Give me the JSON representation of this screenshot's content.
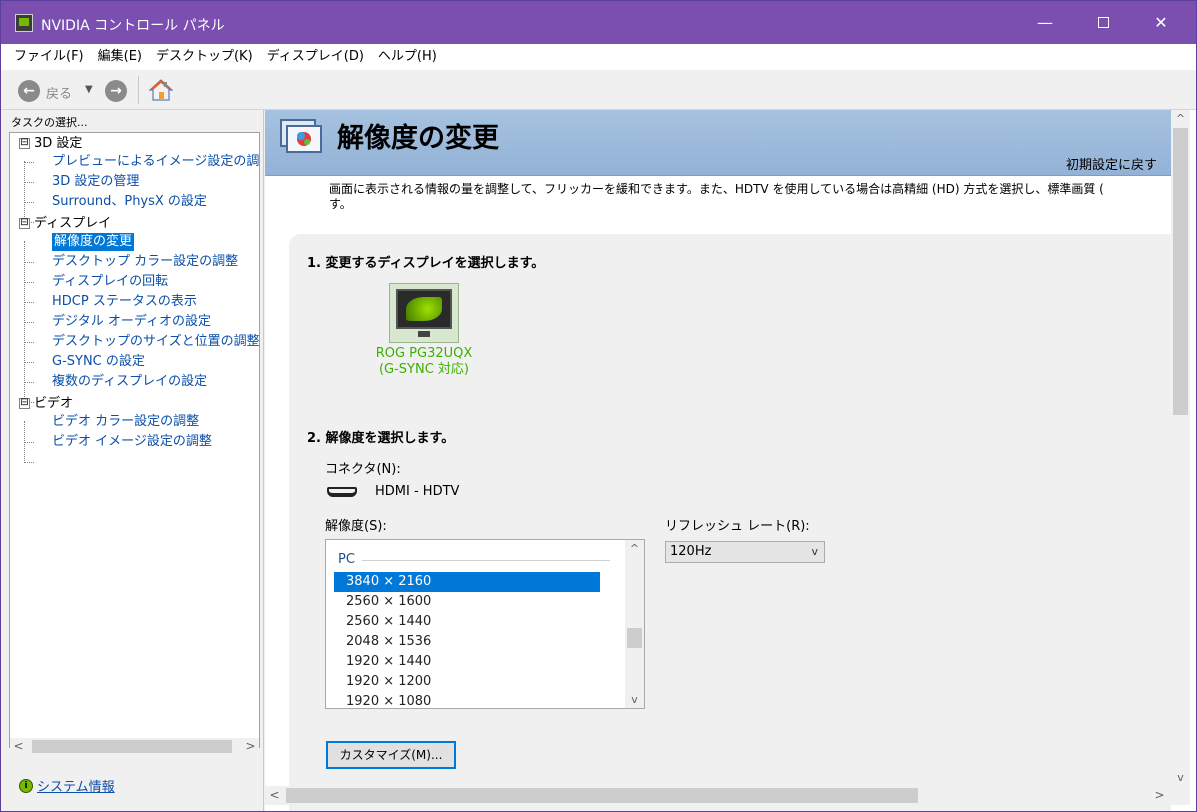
{
  "window": {
    "title": "NVIDIA コントロール パネル",
    "minimize_glyph": "—",
    "close_glyph": "✕"
  },
  "menu": [
    "ファイル(F)",
    "編集(E)",
    "デスクトップ(K)",
    "ディスプレイ(D)",
    "ヘルプ(H)"
  ],
  "toolbar": {
    "back_label": "戻る",
    "back_glyph": "←",
    "forward_glyph": "→",
    "dropdown_glyph": "▼"
  },
  "sidebar": {
    "task_label": "タスクの選択...",
    "tree": [
      {
        "label": "3D 設定",
        "kind": "category",
        "expander": "⊟"
      },
      {
        "label": "プレビューによるイメージ設定の調整",
        "kind": "link"
      },
      {
        "label": "3D 設定の管理",
        "kind": "link"
      },
      {
        "label": "Surround、PhysX の設定",
        "kind": "link"
      },
      {
        "label": "ディスプレイ",
        "kind": "category",
        "expander": "⊟"
      },
      {
        "label": "解像度の変更",
        "kind": "link",
        "selected": true
      },
      {
        "label": "デスクトップ カラー設定の調整",
        "kind": "link"
      },
      {
        "label": "ディスプレイの回転",
        "kind": "link"
      },
      {
        "label": "HDCP ステータスの表示",
        "kind": "link"
      },
      {
        "label": "デジタル オーディオの設定",
        "kind": "link"
      },
      {
        "label": "デスクトップのサイズと位置の調整",
        "kind": "link"
      },
      {
        "label": "G-SYNC の設定",
        "kind": "link"
      },
      {
        "label": "複数のディスプレイの設定",
        "kind": "link"
      },
      {
        "label": "ビデオ",
        "kind": "category",
        "expander": "⊟"
      },
      {
        "label": "ビデオ カラー設定の調整",
        "kind": "link"
      },
      {
        "label": "ビデオ イメージ設定の調整",
        "kind": "link"
      }
    ],
    "system_info": "システム情報",
    "scroll_left": "<",
    "scroll_right": ">"
  },
  "main": {
    "title": "解像度の変更",
    "restore_defaults": "初期設定に戻す",
    "description_line1": "画面に表示される情報の量を調整して、フリッカーを緩和できます。また、HDTV を使用している場合は高精細 (HD) 方式を選択し、標準画質 (",
    "description_line2": "す。",
    "step1_title": "1. 変更するディスプレイを選択します。",
    "display": {
      "name_line1": "ROG PG32UQX",
      "name_line2": "(G-SYNC 対応)"
    },
    "step2_title": "2. 解像度を選択します。",
    "connector_label": "コネクタ(N):",
    "connector_value": "HDMI - HDTV",
    "resolution_label": "解像度(S):",
    "refresh_label": "リフレッシュ レート(R):",
    "refresh_value": "120Hz",
    "resolution_group": "PC",
    "resolutions": [
      "3840 × 2160",
      "2560 × 1600",
      "2560 × 1440",
      "2048 × 1536",
      "1920 × 1440",
      "1920 × 1200",
      "1920 × 1080"
    ],
    "selected_resolution_index": 0,
    "customize_button": "カスタマイズ(M)...",
    "scroll_up": "^",
    "scroll_down": "v",
    "scroll_left": "<",
    "scroll_right": ">"
  }
}
